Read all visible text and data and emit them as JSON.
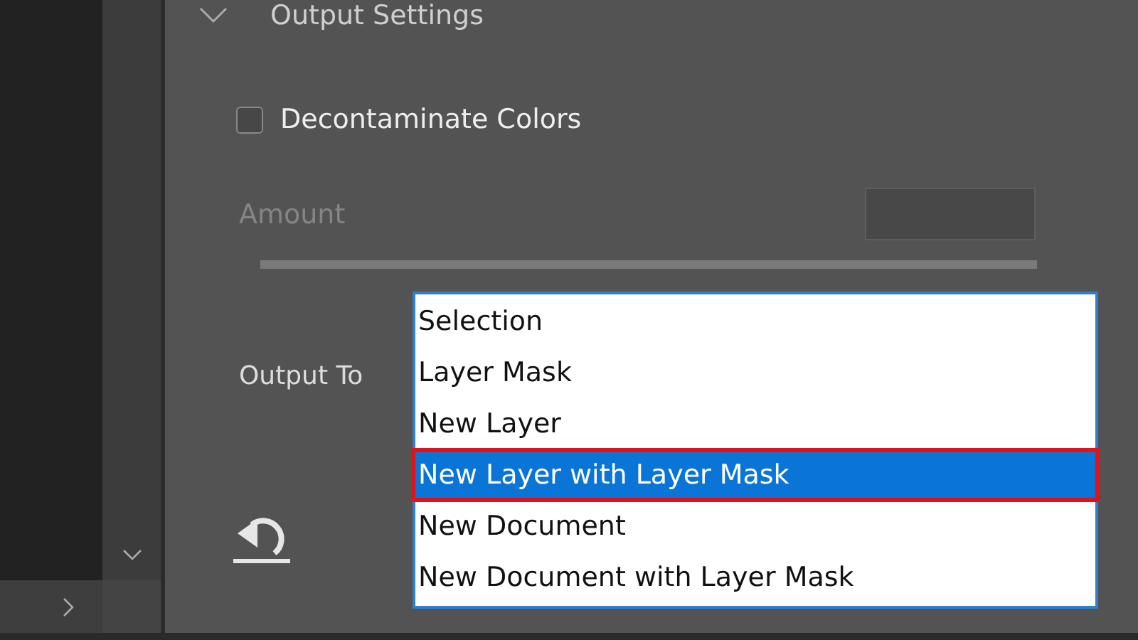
{
  "section": {
    "title": "Output Settings",
    "expanded": true
  },
  "decontaminate": {
    "label": "Decontaminate Colors",
    "checked": false
  },
  "amount": {
    "label": "Amount",
    "disabled": true
  },
  "output_to": {
    "label": "Output To",
    "options": [
      {
        "label": "Selection",
        "selected": false
      },
      {
        "label": "Layer Mask",
        "selected": false
      },
      {
        "label": "New Layer",
        "selected": false
      },
      {
        "label": "New Layer with Layer Mask",
        "selected": true
      },
      {
        "label": "New Document",
        "selected": false
      },
      {
        "label": "New Document with Layer Mask",
        "selected": false
      }
    ]
  }
}
